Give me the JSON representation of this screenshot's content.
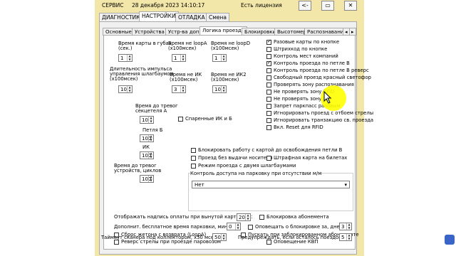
{
  "titlebar": {
    "app": "СЕРВИС",
    "datetime": "28 декабря 2023 14:10:17",
    "license": "Есть лицензия",
    "back_label": "<-",
    "min_label": "▭",
    "close_label": "✕"
  },
  "main_tabs": [
    "ДИАГНОСТИКА",
    "НАСТРОЙКИ",
    "ОТЛАДКА",
    "Смена"
  ],
  "sub_tabs": [
    "Основные",
    "Устройства",
    "Устр-ва доп.",
    "Логика проезда",
    "Блокировки",
    "Высотомер",
    "Распознавание"
  ],
  "fields": {
    "card_time_label": "Время карты в губах\n(сек.)",
    "card_time_value": "1",
    "no_loopA_label": "Время не loopA\n(x100мсек)",
    "no_loopA_value": "1",
    "no_loopD_label": "Время не loopD\n(x100мсек)",
    "no_loopD_value": "1",
    "pulse_label": "Длительность импульса\nуправления шлагбаумом\n(x100мсек)",
    "pulse_value": "10",
    "no_ik_label": "Время не ИК\n(x100мсек)",
    "no_ik_value": "3",
    "no_ik2_label": "Время не ИК2\n(x100мсек)",
    "no_ik2_value": "10",
    "sekcel_label": "Время до тревог\nсекцетеля А",
    "sekcel_value": "10",
    "petlya_label": "Петля Б",
    "petlya_value": "100",
    "ik_label": "ИК",
    "ik_value": "100",
    "ustr_label": "Время до тревог\nустройств, циклов",
    "ustr_value": "100"
  },
  "paired_ik": "Спаренные ИК и Б",
  "right_checks": [
    {
      "label": "Разовые карты по кнопке",
      "on": true
    },
    {
      "label": "Штрихкод по кнопке",
      "on": false
    },
    {
      "label": "Контроль мест компаний",
      "on": false
    },
    {
      "label": "Контроль проезда по петле В",
      "on": true
    },
    {
      "label": "Контроль проезда по петле В реверс",
      "on": false
    },
    {
      "label": "Свободный проезд красный светофор",
      "on": false
    },
    {
      "label": "Проверять зону распознавания",
      "on": false
    },
    {
      "label": "Не проверять зону RFID",
      "on": false
    },
    {
      "label": "Не проверять зону HID",
      "on": false
    },
    {
      "label": "Запрет паркпасс разовым",
      "on": false
    },
    {
      "label": "Игнорировать проезд с отбоем стрелы",
      "on": false
    },
    {
      "label": "Игнорировать транзакцию св. проезда",
      "on": false
    },
    {
      "label": "Вкл. Reset для RFID",
      "on": false
    }
  ],
  "mid_checks": [
    "Блокировать работу с картой до освобождения петли В",
    "Проезд без выдачи носителя",
    "Штрафная карта на билетах",
    "Режим проезда с двумя шлагбаумами"
  ],
  "access_group": {
    "title": "Контроль доступа на парковку при отсутствии м/м",
    "value": "Нет"
  },
  "bottom": {
    "payment_label": "Отображать надпись оплаты при вынутой карте, сек:",
    "payment_value": "20",
    "block_sub": "Блокировка абонемента",
    "free_time_label": "Дополнит. бесплатное время парковки, мин:",
    "free_time_value": "0",
    "notify_block": "Оповещать о блокировке за, дней:",
    "notify_days": "3",
    "reset_token": "Сброс жетона с возврата (LoopA)",
    "let_blocked": "Пускать при заблокированном абонементе",
    "reverse": "Реверс стрелы при проезде паровозом",
    "kvp": "Оповещение КВП",
    "scanner_label": "Таймаут сканера под коллектором, х50 мсек:",
    "scanner_value": "50",
    "warn_label": "Предупреждать, если осталось поездок <=",
    "warn_value": "5"
  }
}
